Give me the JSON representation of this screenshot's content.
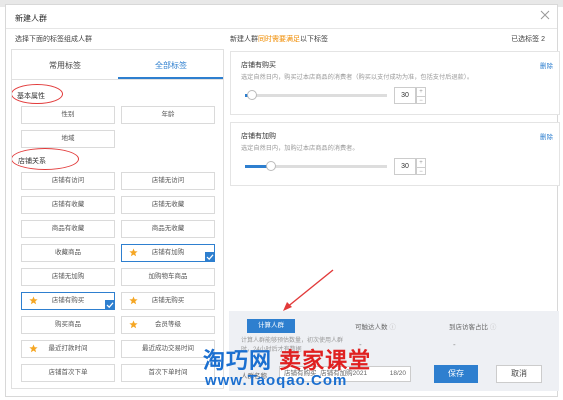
{
  "background_text": "",
  "dialog": {
    "title": "新建人群",
    "left_subtitle": "选择下面的标签组成人群",
    "right_subtitle_prefix": "新建人群",
    "right_subtitle_highlight": "同时需要满足",
    "right_subtitle_suffix": "以下标签",
    "selected_count": "已选标签 2"
  },
  "tabs": [
    "常用标签",
    "全部标签"
  ],
  "active_tab": "全部标签",
  "sections": {
    "basic": "基本属性",
    "shop": "店铺关系"
  },
  "tags": {
    "gender": "性别",
    "age": "年龄",
    "region": "地域",
    "shop_visited": "店铺有访问",
    "shop_not_visited": "店铺无访问",
    "shop_favorited": "店铺有收藏",
    "shop_not_favorited": "店铺无收藏",
    "item_favorited": "商品有收藏",
    "item_not_favorited": "商品无收藏",
    "favorite_items": "收藏商品",
    "shop_has_cart": "店铺有加购",
    "shop_no_cart": "店铺无加购",
    "cart_items": "加购物车商品",
    "shop_purchased": "店铺有购买",
    "shop_not_purchased": "店铺无购买",
    "purchased_items": "购买商品",
    "member_level": "会员等级",
    "recent_open": "最近打款时间",
    "recent_trade": "最近成功交易时间",
    "shop_first_order": "店铺首次下单",
    "first_order_time": "首次下单时间"
  },
  "conditions": [
    {
      "name": "店铺有购买",
      "desc": "选定自然日内，购买过本店商品的消费者（购买以支付成功为准，包括支付后退款）。",
      "delete": "删除",
      "value": "30",
      "fill": 0.05
    },
    {
      "name": "店铺有加购",
      "desc": "选定自然日内，加购过本店商品的消费者。",
      "delete": "删除",
      "value": "30",
      "fill": 0.18
    }
  ],
  "footer": {
    "calc_button": "计算人群",
    "note": "计算人群能够预估数量，初次使用人群时，24小时后才有数据",
    "reach_label": "可触达人数",
    "reach_value": "-",
    "visitor_label": "到店访客占比",
    "visitor_value": "-",
    "name_label": "人群名称",
    "name_value": "店铺有购买_店铺有加购2021",
    "name_count": "18/20",
    "save": "保存",
    "cancel": "取消"
  },
  "watermark": {
    "brand": "淘巧网",
    "slogan": "卖家课堂",
    "url": "www.Taoqao.Com"
  },
  "colors": {
    "accent": "#2e7fcf",
    "annotation": "#e23a3a",
    "star": "#f5a623"
  }
}
